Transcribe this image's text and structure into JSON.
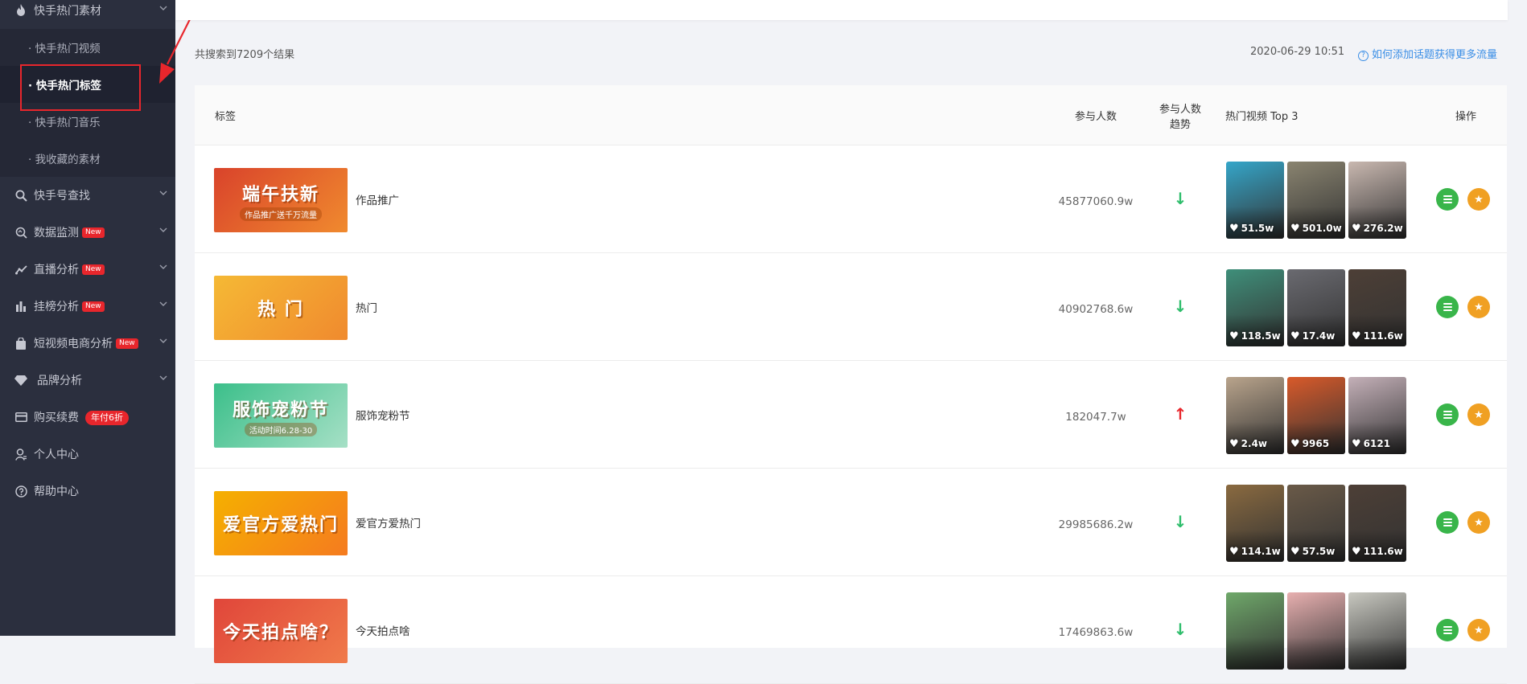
{
  "sidebar": {
    "items": [
      {
        "id": "hot-materials",
        "label": "快手热门素材",
        "icon": "fire-icon"
      },
      {
        "id": "account-search",
        "label": "快手号查找",
        "icon": "search-icon"
      },
      {
        "id": "data-monitor",
        "label": "数据监测",
        "icon": "monitor-search-icon",
        "badge": "New"
      },
      {
        "id": "live-analysis",
        "label": "直播分析",
        "icon": "trend-line-icon",
        "badge": "New"
      },
      {
        "id": "goods-analysis",
        "label": "挂榜分析",
        "icon": "bar-chart-icon",
        "badge": "New"
      },
      {
        "id": "ecommerce-analysis",
        "label": "短视频电商分析",
        "icon": "shopping-bag-icon",
        "badge": "New"
      },
      {
        "id": "brand-analysis",
        "label": "品牌分析",
        "icon": "diamond-icon"
      },
      {
        "id": "purchase",
        "label": "购买续费",
        "icon": "card-icon",
        "promo": "年付6折"
      },
      {
        "id": "personal-center",
        "label": "个人中心",
        "icon": "user-icon"
      },
      {
        "id": "help-center",
        "label": "帮助中心",
        "icon": "help-circle-icon"
      }
    ],
    "subitems": [
      {
        "label": "· 快手热门视频",
        "active": false
      },
      {
        "label": "· 快手热门标签",
        "active": true
      },
      {
        "label": "· 快手热门音乐",
        "active": false
      },
      {
        "label": "· 我收藏的素材",
        "active": false
      }
    ]
  },
  "summary": "共搜索到7209个结果",
  "datetime": "2020-06-29 10:51",
  "help_link": "如何添加话题获得更多流量",
  "table": {
    "headers": {
      "tag": "标签",
      "participants": "参与人数",
      "trend_line1": "参与人数",
      "trend_line2": "趋势",
      "top_videos": "热门视频 Top 3",
      "actions": "操作"
    },
    "rows": [
      {
        "thumb_text": "端午扶新",
        "thumb_sub": "作品推广送千万流量",
        "thumb_colors": [
          "#d9432b",
          "#f08a2e"
        ],
        "tag": "作品推广",
        "participants": "45877060.9w",
        "trend": "down",
        "trend_symbol": "↓",
        "videos": [
          {
            "likes": "51.5w",
            "color": "#35a6c9"
          },
          {
            "likes": "501.0w",
            "color": "#8a8470"
          },
          {
            "likes": "276.2w",
            "color": "#c9b8b0"
          }
        ]
      },
      {
        "thumb_text": "热 门",
        "thumb_colors": [
          "#f5b935",
          "#f08a2e"
        ],
        "tag": "热门",
        "participants": "40902768.6w",
        "trend": "down",
        "trend_symbol": "↓",
        "videos": [
          {
            "likes": "118.5w",
            "color": "#3f8f7a"
          },
          {
            "likes": "17.4w",
            "color": "#6a6a70"
          },
          {
            "likes": "111.6w",
            "color": "#4d3f36"
          }
        ]
      },
      {
        "thumb_text": "服饰宠粉节",
        "thumb_sub": "活动时间6.28-30",
        "thumb_colors": [
          "#3bbf8a",
          "#a6e0c6"
        ],
        "tag": "服饰宠粉节",
        "participants": "182047.7w",
        "trend": "up",
        "trend_symbol": "↑",
        "videos": [
          {
            "likes": "2.4w",
            "color": "#b9a48c"
          },
          {
            "likes": "9965",
            "color": "#d95a2a"
          },
          {
            "likes": "6121",
            "color": "#c4b0b8"
          }
        ]
      },
      {
        "thumb_text": "爱官方爱热门",
        "thumb_colors": [
          "#f5b000",
          "#f57b1f"
        ],
        "tag": "爱官方爱热门",
        "participants": "29985686.2w",
        "trend": "down",
        "trend_symbol": "↓",
        "videos": [
          {
            "likes": "114.1w",
            "color": "#8a6a40"
          },
          {
            "likes": "57.5w",
            "color": "#6a5a48"
          },
          {
            "likes": "111.6w",
            "color": "#4d3f36"
          }
        ]
      },
      {
        "thumb_text": "今天拍点啥？",
        "thumb_colors": [
          "#e0463a",
          "#f07a4a"
        ],
        "tag": "今天拍点啥",
        "participants": "17469863.6w",
        "trend": "down",
        "trend_symbol": "↓",
        "videos": [
          {
            "likes": "",
            "color": "#6fa86a"
          },
          {
            "likes": "",
            "color": "#e8b0b0"
          },
          {
            "likes": "",
            "color": "#c8c8c0"
          }
        ]
      }
    ]
  },
  "colors": {
    "sidebar_bg": "#2b2f3e",
    "accent_red": "#e8262c",
    "link_blue": "#3a8ee6",
    "trend_down": "#2ebd6b",
    "trend_up": "#e8262c",
    "btn_green": "#39b54a",
    "btn_orange": "#f0a023"
  }
}
